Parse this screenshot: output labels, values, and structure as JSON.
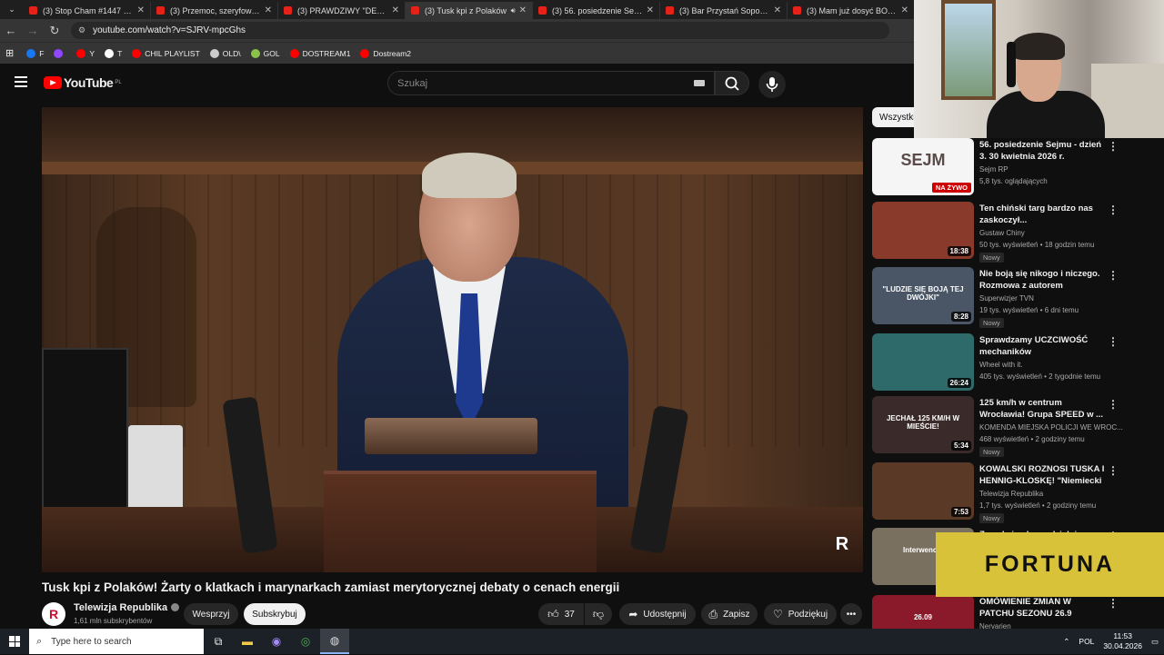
{
  "browser": {
    "tabs": [
      {
        "title": "(3) Stop Cham #1447 - N"
      },
      {
        "title": "(3) Przemoc, szeryfowanie"
      },
      {
        "title": "(3) PRAWDZIWY \"DESPER"
      },
      {
        "title": "(3) Tusk kpi z Polaków",
        "active": true
      },
      {
        "title": "(3) 56. posiedzenie Sejmu"
      },
      {
        "title": "(3) Bar Przystań Sopot —"
      },
      {
        "title": "(3) Mam już dosyć BOGA"
      }
    ],
    "url": "youtube.com/watch?v=SJRV-mpcGhs",
    "bookmarks": [
      {
        "label": "F",
        "icon": "facebook-icon",
        "color": "#1877f2"
      },
      {
        "label": "",
        "icon": "twitch-icon",
        "color": "#9146ff"
      },
      {
        "label": "Y",
        "icon": "youtube-icon",
        "color": "#ff0000"
      },
      {
        "label": "T",
        "icon": "x-icon",
        "color": "#ffffff"
      },
      {
        "label": "CHIL PLAYLIST",
        "icon": "youtube-icon",
        "color": "#ff0000"
      },
      {
        "label": "OLD\\",
        "icon": "folder-icon",
        "color": "#cccccc"
      },
      {
        "label": "GOL",
        "icon": "gol-icon",
        "color": "#8bc34a"
      },
      {
        "label": "DOSTREAM1",
        "icon": "youtube-icon",
        "color": "#ff0000"
      },
      {
        "label": "Dostream2",
        "icon": "youtube-icon",
        "color": "#ff0000"
      }
    ]
  },
  "header": {
    "logo_text": "YouTube",
    "country": "PL",
    "search_placeholder": "Szukaj"
  },
  "video": {
    "title": "Tusk kpi z Polaków! Żarty o klatkach i marynarkach zamiast merytorycznej debaty o cenach energii",
    "channel": "Telewizja Republika",
    "subscribers": "1,61 mln subskrybentów",
    "support_label": "Wesprzyj",
    "subscribe_label": "Subskrybuj",
    "likes": "37",
    "share_label": "Udostępnij",
    "save_label": "Zapisz",
    "thanks_label": "Podziękuj",
    "watermark": "R"
  },
  "sidebar": {
    "chip": "Wszystki",
    "items": [
      {
        "title": "56. posiedzenie Sejmu - dzień 3. 30 kwietnia 2026 r.",
        "channel": "Sejm RP",
        "meta": "5,8 tys. oglądających",
        "badge": "",
        "live": "NA ŻYWO",
        "duration": "",
        "thumb_color": "#f5f5f5",
        "thumb_text": "SEJM"
      },
      {
        "title": "Ten chiński targ bardzo nas zaskoczył...",
        "channel": "Gustaw Chiny",
        "meta": "50 tys. wyświetleń • 18 godzin temu",
        "badge": "Nowy",
        "live": "",
        "duration": "18:38",
        "thumb_color": "#8a3a2a",
        "thumb_text": ""
      },
      {
        "title": "Nie boją się nikogo i niczego. Rozmowa z autorem reportażu...",
        "channel": "Superwizjer TVN",
        "meta": "19 tys. wyświetleń • 6 dni temu",
        "badge": "Nowy",
        "live": "",
        "duration": "8:28",
        "thumb_color": "#4a5666",
        "thumb_text": "\"LUDZIE SIĘ BOJĄ TEJ DWÓJKI\""
      },
      {
        "title": "Sprawdzamy UCZCIWOŚĆ mechaników samochodowych!",
        "channel": "Wheel with it.",
        "meta": "405 tys. wyświetleń • 2 tygodnie temu",
        "badge": "",
        "live": "",
        "duration": "26:24",
        "thumb_color": "#2f6a6a",
        "thumb_text": ""
      },
      {
        "title": "125 km/h w centrum Wrocławia! Grupa SPEED w ...",
        "channel": "KOMENDA MIEJSKA POLICJI WE WROC...",
        "meta": "468 wyświetleń • 2 godziny temu",
        "badge": "Nowy",
        "live": "",
        "duration": "5:34",
        "thumb_color": "#3a2a2a",
        "thumb_text": "JECHAŁ 125 KM/H W MIEŚCIE!"
      },
      {
        "title": "KOWALSKI ROZNOSI TUSKA I HENNIG-KLOSKĘ! \"Niemiecki ...",
        "channel": "Telewizja Republika",
        "meta": "1,7 tys. wyświetleń • 2 godziny temu",
        "badge": "Nowy",
        "live": "",
        "duration": "7:53",
        "thumb_color": "#5a3a26",
        "thumb_text": ""
      },
      {
        "title": "Zamykają plac w dzielni... Zaliczki przepadły, rozkodowani...",
        "channel": "",
        "meta": "",
        "badge": "",
        "live": "",
        "duration": "",
        "thumb_color": "#7a7060",
        "thumb_text": "Interwencja"
      },
      {
        "title": "OMÓWIENIE ZMIAN W PATCHU SEZONU 26.9 LEAGUE OF ...",
        "channel": "Nervarien",
        "meta": "",
        "badge": "",
        "live": "",
        "duration": "",
        "thumb_color": "#8a1a2a",
        "thumb_text": "26.09"
      }
    ]
  },
  "overlay": {
    "sponsor": "FORTUNA"
  },
  "taskbar": {
    "search_placeholder": "Type here to search",
    "language": "POL",
    "time": "11:53",
    "date": "30.04.2026"
  }
}
